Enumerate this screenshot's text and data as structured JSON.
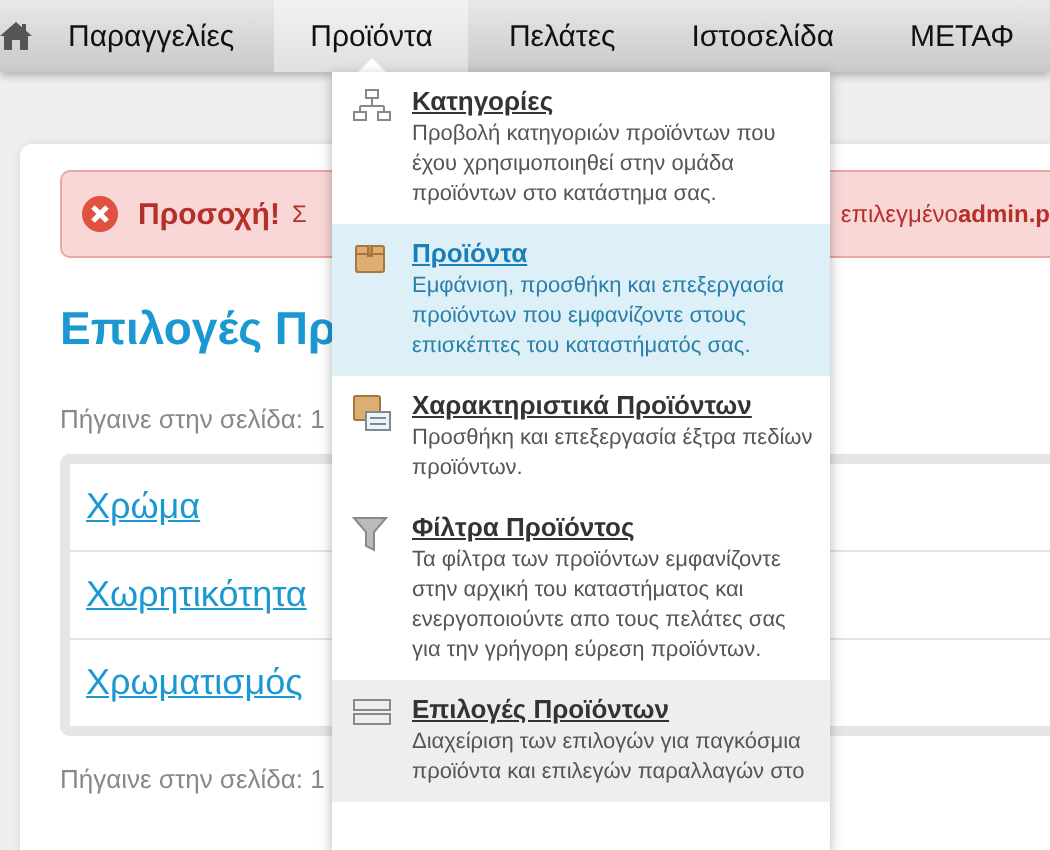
{
  "nav": {
    "items": [
      {
        "label": "Παραγγελίες",
        "selected": false
      },
      {
        "label": "Προϊόντα",
        "selected": true
      },
      {
        "label": "Πελάτες",
        "selected": false
      },
      {
        "label": "Ιστοσελίδα",
        "selected": false
      },
      {
        "label": "ΜΕΤΑΦ",
        "selected": false
      }
    ]
  },
  "alert": {
    "title": "Προσοχή!",
    "text_start": "Σ",
    "text_end": "επιλεγμένο**admin.p**"
  },
  "heading": "Επιλογές Πρ",
  "pager_top": "Πήγαινε στην σελίδα: 1",
  "options": [
    "Χρώμα",
    "Χωρητικότητα",
    "Χρωματισμός"
  ],
  "pager_bottom": "Πήγαινε στην σελίδα: 1",
  "dropdown": {
    "items": [
      {
        "kind": "categories",
        "title": "Κατηγορίες",
        "description": "Προβολή κατηγοριών προϊόντων που έχου χρησιμοποιηθεί στην ομάδα προϊόντων στο κατάστημα σας.",
        "selected": false,
        "hovered": false
      },
      {
        "kind": "products",
        "title": "Προϊόντα",
        "description": "Εμφάνιση, προσθήκη και επεξεργασία προϊόντων που εμφανίζοντε στους επισκέπτες του καταστήματός σας.",
        "selected": true,
        "hovered": false
      },
      {
        "kind": "attributes",
        "title": "Χαρακτηριστικά Προϊόντων",
        "description": "Προσθήκη και επεξεργασία έξτρα πεδίων προϊόντων.",
        "selected": false,
        "hovered": false
      },
      {
        "kind": "filters",
        "title": "Φίλτρα Προϊόντος",
        "description": "Τα φίλτρα των προϊόντων εμφανίζοντε στην αρχική του καταστήματος και ενεργοποιούντε απο τους πελάτες σας για την γρήγορη εύρεση προϊόντων.",
        "selected": false,
        "hovered": false
      },
      {
        "kind": "options",
        "title": "Επιλογές Προϊόντων",
        "description": "Διαχείριση των επιλογών για παγκόσμια προϊόντα και επιλεγών παραλλαγών στο",
        "selected": false,
        "hovered": true
      }
    ]
  }
}
